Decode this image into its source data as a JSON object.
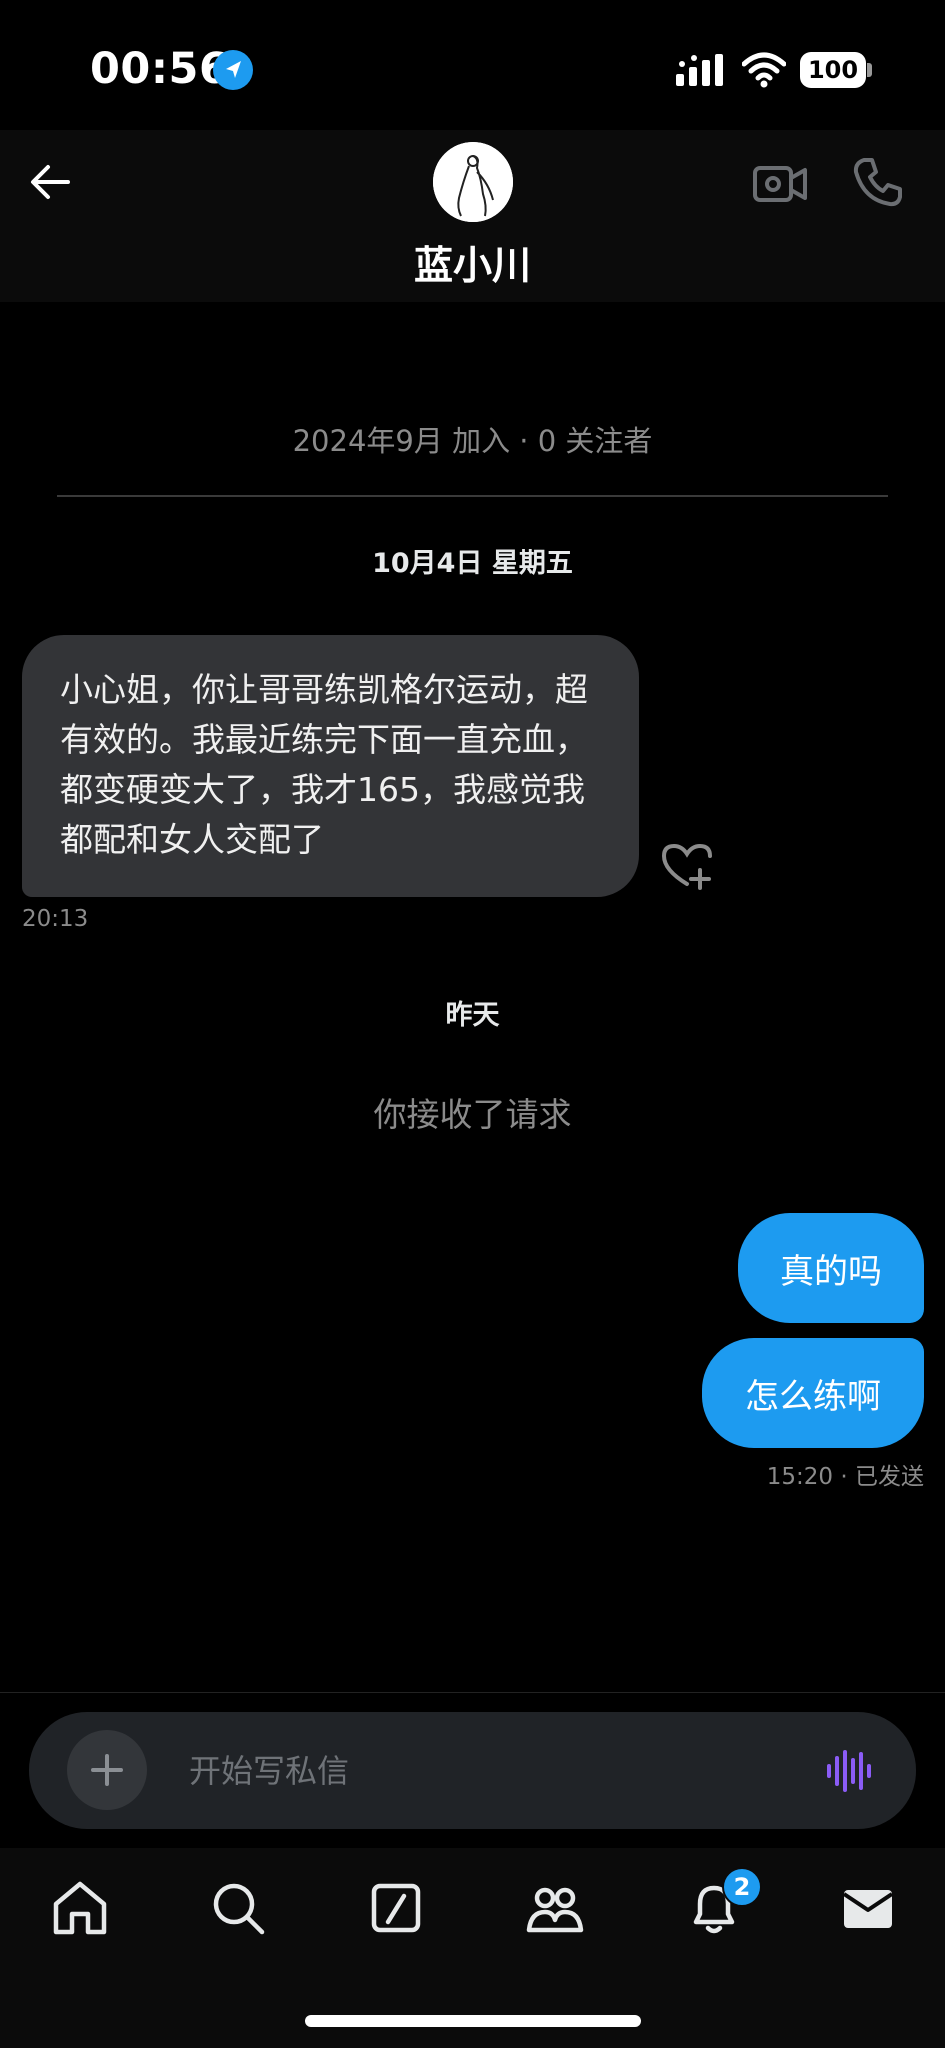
{
  "status_bar": {
    "time": "00:56",
    "battery": "100"
  },
  "header": {
    "contact_name": "蓝小川"
  },
  "conversation": {
    "joined_info": "2024年9月 加入 · 0 关注者",
    "day_label_1": "10月4日 星期五",
    "incoming_message": "小心姐，你让哥哥练凯格尔运动，超有效的。我最近练完下面一直充血，都变硬变大了，我才165，我感觉我都配和女人交配了",
    "incoming_time": "20:13",
    "day_label_2": "昨天",
    "system_message": "你接收了请求",
    "outgoing_messages": [
      "真的吗",
      "怎么练啊"
    ],
    "outgoing_status": "15:20 · 已发送"
  },
  "composer": {
    "placeholder": "开始写私信"
  },
  "tab_bar": {
    "icons": [
      "home-icon",
      "search-icon",
      "compose-icon",
      "communities-icon",
      "notifications-icon",
      "messages-icon"
    ],
    "notification_badge": "2"
  },
  "colors": {
    "accent": "#1d9bf0",
    "bubble_incoming": "#333437",
    "background": "#000000",
    "voice_icon": "#8b5cf6"
  }
}
